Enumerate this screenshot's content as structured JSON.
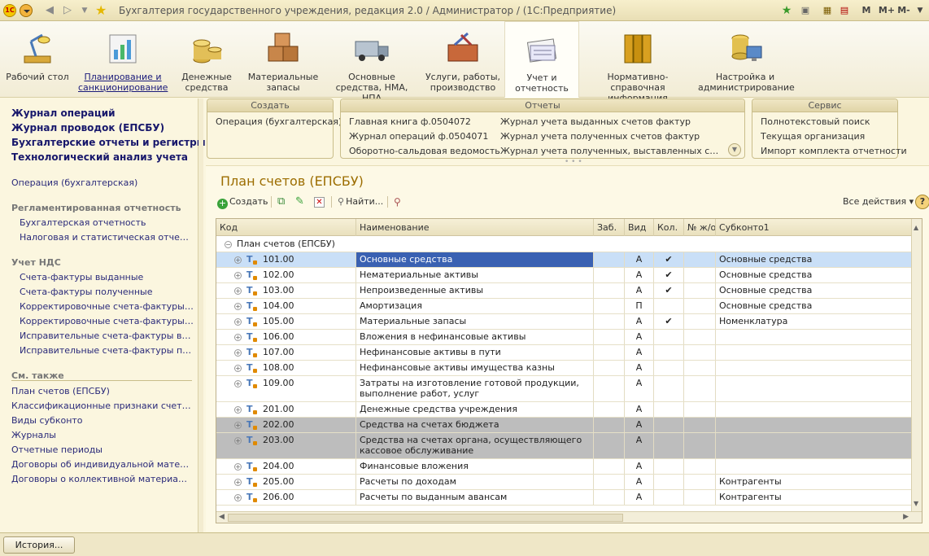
{
  "window": {
    "title": "Бухгалтерия государственного учреждения, редакция 2.0 / Администратор / (1С:Предприятие)",
    "logo_text": "1С",
    "memory_buttons": [
      "M",
      "M+",
      "M-"
    ]
  },
  "sections": [
    {
      "label": "Рабочий стол",
      "icon": "desk-lamp-icon"
    },
    {
      "label": "Планирование и санкционирование",
      "icon": "chart-icon"
    },
    {
      "label": "Денежные средства",
      "icon": "coins-icon"
    },
    {
      "label": "Материальные запасы",
      "icon": "crates-icon"
    },
    {
      "label": "Основные средства, НМА, НПА",
      "icon": "truck-icon"
    },
    {
      "label": "Услуги, работы, производство",
      "icon": "toolbox-icon"
    },
    {
      "label": "Учет и отчетность",
      "icon": "ledger-icon"
    },
    {
      "label": "Нормативно-справочная информация",
      "icon": "binders-icon"
    },
    {
      "label": "Настройка и администрирование",
      "icon": "admin-icon"
    }
  ],
  "leftnav": {
    "bold_links": [
      "Журнал операций",
      "Журнал проводок (ЕПСБУ)",
      "Бухгалтерские отчеты и регистры",
      "Технологический анализ учета"
    ],
    "operation_link": "Операция (бухгалтерская)",
    "regulated_header": "Регламентированная отчетность",
    "regulated_items": [
      "Бухгалтерская отчетность",
      "Налоговая и статистическая отчетность"
    ],
    "vat_header": "Учет НДС",
    "vat_items": [
      "Счета-фактуры выданные",
      "Счета-фактуры полученные",
      "Корректировочные счета-фактуры выданные",
      "Корректировочные счета-фактуры полученные",
      "Исправительные счета-фактуры выданные",
      "Исправительные счета-фактуры полученные"
    ],
    "see_also_header": "См. также",
    "see_also_items": [
      "План счетов (ЕПСБУ)",
      "Классификационные признаки счетов (КОСГУ)",
      "Виды субконто",
      "Журналы",
      "Отчетные периоды",
      "Договоры об индивидуальной материальной ответственности",
      "Договоры о коллективной материальной ответственности"
    ]
  },
  "groups": {
    "create": {
      "title": "Создать",
      "items": [
        "Операция (бухгалтерская)"
      ]
    },
    "reports": {
      "title": "Отчеты",
      "col1": [
        "Главная книга ф.0504072",
        "Журнал операций ф.0504071",
        "Оборотно-сальдовая ведомость"
      ],
      "col2": [
        "Журнал учета выданных счетов фактур",
        "Журнал учета полученных счетов фактур",
        "Журнал учета полученных, выставленных счетов фактур"
      ]
    },
    "service": {
      "title": "Сервис",
      "items": [
        "Полнотекстовый поиск",
        "Текущая организация",
        "Импорт комплекта отчетности"
      ]
    }
  },
  "content": {
    "title": "План счетов (ЕПСБУ)",
    "toolbar": {
      "create": "Создать",
      "find": "Найти...",
      "all_actions": "Все действия ▾",
      "help": "?"
    }
  },
  "grid": {
    "columns": [
      "Код",
      "Наименование",
      "Заб.",
      "Вид",
      "Кол.",
      "№ ж/о",
      "Субконто1"
    ],
    "root": "План счетов (ЕПСБУ)",
    "rows": [
      {
        "code": "101.00",
        "name": "Основные средства",
        "vid": "А",
        "kol": "✔",
        "sub": "Основные средства",
        "state": "selected"
      },
      {
        "code": "102.00",
        "name": "Нематериальные активы",
        "vid": "А",
        "kol": "✔",
        "sub": "Основные средства",
        "state": ""
      },
      {
        "code": "103.00",
        "name": "Непроизведенные активы",
        "vid": "А",
        "kol": "✔",
        "sub": "Основные средства",
        "state": ""
      },
      {
        "code": "104.00",
        "name": "Амортизация",
        "vid": "П",
        "kol": "",
        "sub": "Основные средства",
        "state": ""
      },
      {
        "code": "105.00",
        "name": "Материальные запасы",
        "vid": "А",
        "kol": "✔",
        "sub": "Номенклатура",
        "state": ""
      },
      {
        "code": "106.00",
        "name": "Вложения в нефинансовые активы",
        "vid": "А",
        "kol": "",
        "sub": "",
        "state": ""
      },
      {
        "code": "107.00",
        "name": "Нефинансовые активы в пути",
        "vid": "А",
        "kol": "",
        "sub": "",
        "state": ""
      },
      {
        "code": "108.00",
        "name": "Нефинансовые активы имущества казны",
        "vid": "А",
        "kol": "",
        "sub": "",
        "state": ""
      },
      {
        "code": "109.00",
        "name": "Затраты на изготовление готовой продукции, выполнение работ, услуг",
        "vid": "А",
        "kol": "",
        "sub": "",
        "state": "",
        "tall": true
      },
      {
        "code": "201.00",
        "name": "Денежные средства учреждения",
        "vid": "А",
        "kol": "",
        "sub": "",
        "state": ""
      },
      {
        "code": "202.00",
        "name": "Средства на счетах бюджета",
        "vid": "А",
        "kol": "",
        "sub": "",
        "state": "gray"
      },
      {
        "code": "203.00",
        "name": "Средства на счетах органа, осуществляющего кассовое обслуживание",
        "vid": "А",
        "kol": "",
        "sub": "",
        "state": "gray",
        "tall": true
      },
      {
        "code": "204.00",
        "name": "Финансовые вложения",
        "vid": "А",
        "kol": "",
        "sub": "",
        "state": ""
      },
      {
        "code": "205.00",
        "name": "Расчеты по доходам",
        "vid": "А",
        "kol": "",
        "sub": "Контрагенты",
        "state": ""
      },
      {
        "code": "206.00",
        "name": "Расчеты по выданным авансам",
        "vid": "А",
        "kol": "",
        "sub": "Контрагенты",
        "state": ""
      }
    ]
  },
  "bottom": {
    "history": "История..."
  }
}
